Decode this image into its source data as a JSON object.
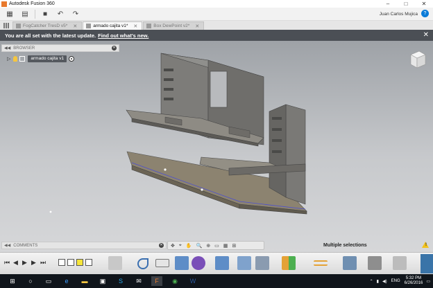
{
  "window": {
    "title": "Autodesk Fusion 360",
    "controls": [
      "minimize-icon",
      "maximize-icon",
      "close-icon"
    ]
  },
  "toolbar": {
    "user_name": "Juan Carlos Mujica",
    "help_label": "?"
  },
  "tabs": [
    {
      "label": "FogCatcher TresD v5*",
      "active": false
    },
    {
      "label": "armado cajita v1*",
      "active": true
    },
    {
      "label": "Box DewPoint v2*",
      "active": false
    }
  ],
  "notification": {
    "message": "You are all set with the latest update.",
    "link": "Find out what's new."
  },
  "browser": {
    "title": "BROWSER",
    "root_item": "armado cajita v1"
  },
  "comments": {
    "title": "COMMENTS"
  },
  "status": {
    "selection": "Multiple selections"
  },
  "bottom_toolbar": {
    "tools": [
      "SKETCH",
      "CREATE",
      "MODIFY",
      "ASSEMBLE",
      "CONSTRUCT",
      "INSPECT",
      "INSERT",
      "MAKE",
      "ADD-INS",
      "SELECT"
    ]
  },
  "taskbar": {
    "language": "ENG",
    "time": "5:32 PM",
    "date": "6/26/2016"
  },
  "colors": {
    "notification_bg": "#4b4f55",
    "canvas_top": "#9ea2a7",
    "canvas_bottom": "#d6d7d9",
    "taskbar_bg": "#10151b",
    "accent": "#3a74a8"
  }
}
